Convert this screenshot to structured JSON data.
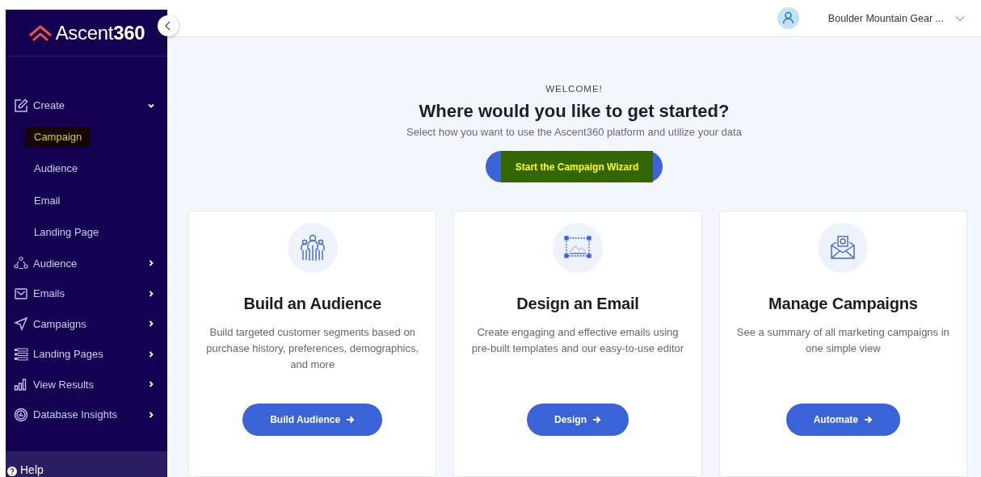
{
  "sidebar": {
    "logo": "Ascent**360**",
    "nav": [
      {
        "label": "Create",
        "expanded": true,
        "children": [
          {
            "label": "Campaign",
            "selected": true
          },
          {
            "label": "Audience",
            "selected": false
          },
          {
            "label": "Email",
            "selected": false
          },
          {
            "label": "Landing Page",
            "selected": false
          }
        ]
      },
      {
        "label": "Audience",
        "expanded": false
      },
      {
        "label": "Emails",
        "expanded": false
      },
      {
        "label": "Campaigns",
        "expanded": false
      },
      {
        "label": "Landing Pages",
        "expanded": false
      },
      {
        "label": "View Results",
        "expanded": false
      },
      {
        "label": "Database Insights",
        "expanded": false
      }
    ],
    "help": "Help"
  },
  "header": {
    "account": "Boulder Mountain Gear ..."
  },
  "welcome": {
    "eyebrow": "WELCOME!",
    "title": "Where would you like to get started?",
    "subtitle": "Select how you want to use the Ascent360 platform and utilize your data",
    "button": {
      "label": "Start the Campaign Wizard",
      "highlighted": true
    }
  },
  "cards": [
    {
      "title": "Build an Audience",
      "description": "Build targeted customer segments based on purchase history, preferences, demographics, and more",
      "button": "Build Audience"
    },
    {
      "title": "Design an Email",
      "description": "Create engaging and effective emails using pre-built templates and our easy-to-use editor",
      "button": "Design"
    },
    {
      "title": "Manage Campaigns",
      "description": "See a summary of all marketing campaigns in one simple view",
      "button": "Automate"
    }
  ]
}
